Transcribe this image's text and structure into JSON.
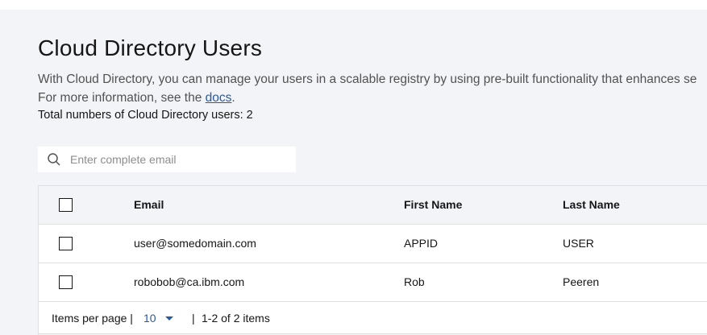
{
  "page": {
    "title": "Cloud Directory Users",
    "description_line1": "With Cloud Directory, you can manage your users in a scalable registry by using pre-built functionality that enhances se",
    "description_line2_prefix": "For more information, see the ",
    "docs_link": "docs",
    "description_line2_suffix": ".",
    "total_users": "Total numbers of Cloud Directory users: 2"
  },
  "search": {
    "placeholder": "Enter complete email",
    "value": "",
    "icon": "search-icon"
  },
  "table": {
    "columns": [
      "Email",
      "First Name",
      "Last Name"
    ],
    "rows": [
      {
        "email": "user@somedomain.com",
        "first_name": "APPID",
        "last_name": "USER"
      },
      {
        "email": "robobob@ca.ibm.com",
        "first_name": "Rob",
        "last_name": "Peeren"
      }
    ]
  },
  "pagination": {
    "items_per_page_label": "Items per page |",
    "items_per_page_value": "10",
    "separator": "|",
    "range": "1-2 of 2 items"
  },
  "colors": {
    "background": "#f3f4f8",
    "link": "#2a5a9e",
    "text": "#161616",
    "secondary_text": "#525252"
  }
}
